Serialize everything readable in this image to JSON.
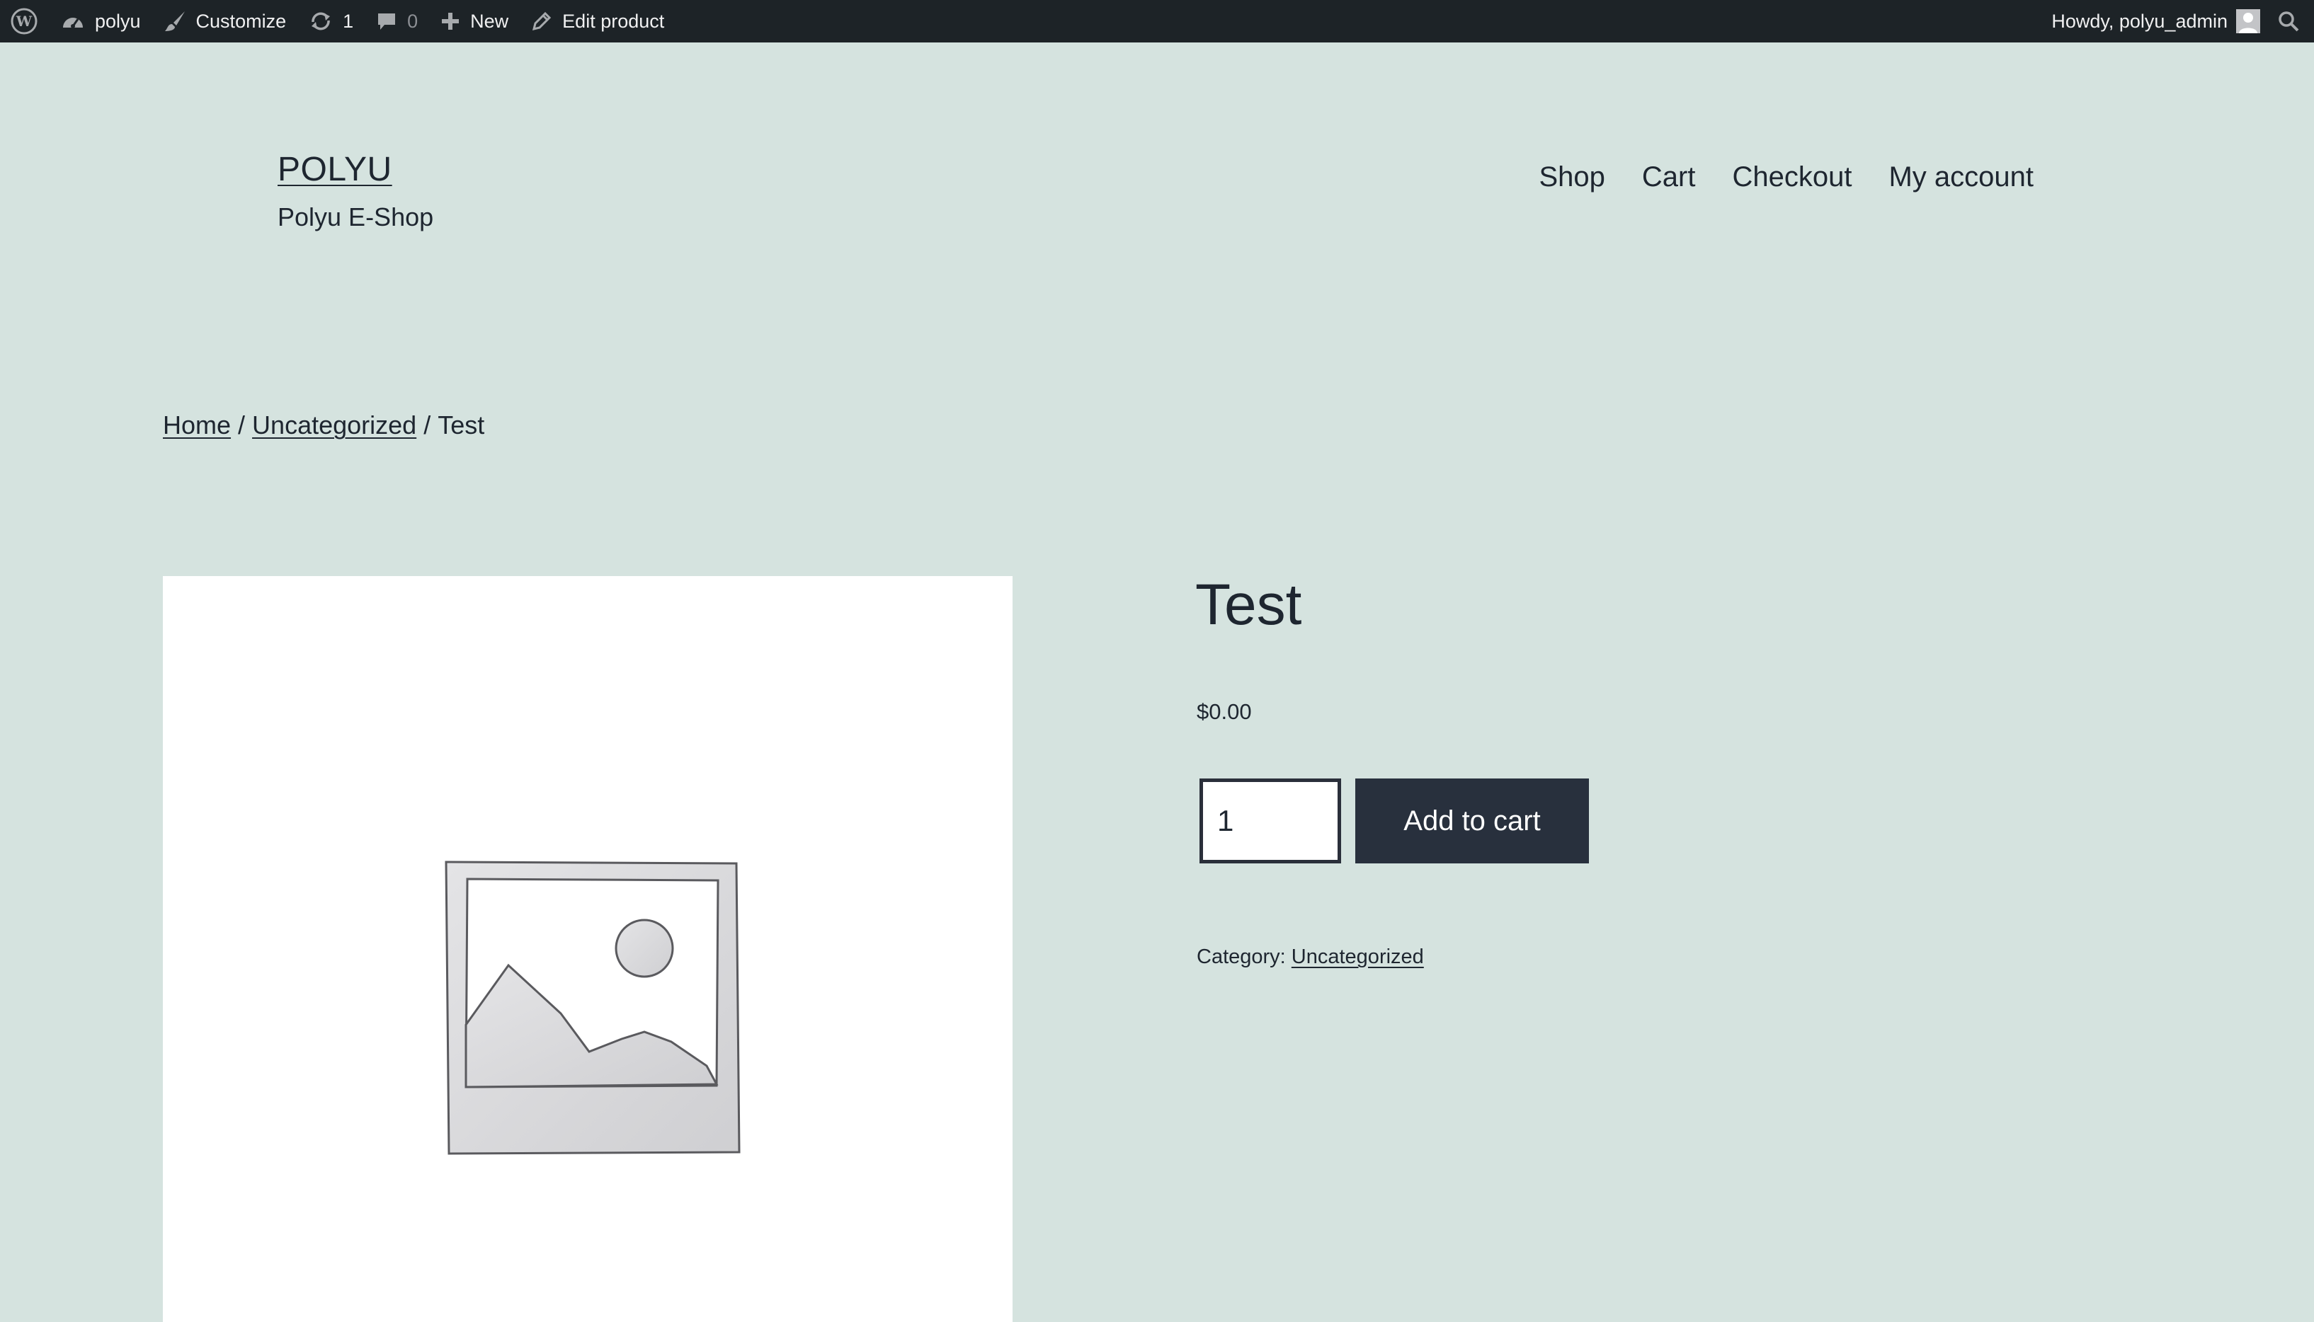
{
  "admin_bar": {
    "site_name": "polyu",
    "customize_label": "Customize",
    "updates_count": "1",
    "comments_count": "0",
    "new_label": "New",
    "edit_label": "Edit product",
    "greeting": "Howdy, polyu_admin",
    "icons": [
      "wordpress-icon",
      "dashboard-icon",
      "brush-icon",
      "updates-icon",
      "comment-icon",
      "plus-icon",
      "pencil-icon",
      "user-avatar-icon",
      "search-icon"
    ]
  },
  "header": {
    "site_title": "POLYU",
    "tagline": "Polyu E-Shop",
    "nav": [
      "Shop",
      "Cart",
      "Checkout",
      "My account"
    ]
  },
  "breadcrumb": {
    "home": "Home",
    "separator": "/",
    "category": "Uncategorized",
    "current": "Test"
  },
  "product": {
    "title": "Test",
    "price": "$0.00",
    "quantity": "1",
    "add_to_cart_label": "Add to cart",
    "category_label": "Category:",
    "category_value": "Uncategorized",
    "image": "placeholder-image-icon"
  },
  "colors": {
    "background": "#d5e3df",
    "admin_bar": "#1d2327",
    "button": "#28303d",
    "text": "#1e2630"
  }
}
